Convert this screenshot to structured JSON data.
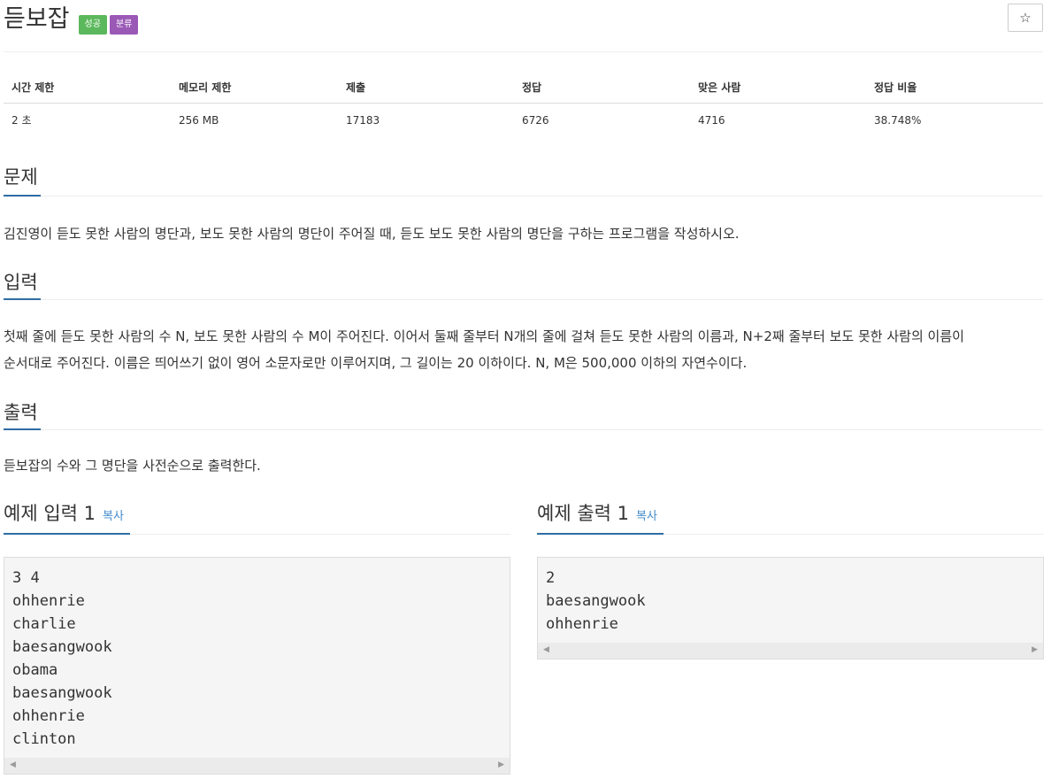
{
  "problem": {
    "title": "듣보잡",
    "badges": {
      "success": "성공",
      "category": "분류"
    },
    "star_icon": "☆"
  },
  "info_table": {
    "headers": [
      "시간 제한",
      "메모리 제한",
      "제출",
      "정답",
      "맞은 사람",
      "정답 비율"
    ],
    "values": [
      "2 초",
      "256 MB",
      "17183",
      "6726",
      "4716",
      "38.748%"
    ]
  },
  "sections": {
    "description": {
      "title": "문제",
      "text": "김진영이 듣도 못한 사람의 명단과, 보도 못한 사람의 명단이 주어질 때, 듣도 보도 못한 사람의 명단을 구하는 프로그램을 작성하시오."
    },
    "input": {
      "title": "입력",
      "line1": "첫째 줄에 듣도 못한 사람의 수 N, 보도 못한 사람의 수 M이 주어진다. 이어서 둘째 줄부터 N개의 줄에 걸쳐 듣도 못한 사람의 이름과, N+2째 줄부터 보도 못한 사람의 이름이",
      "line2": "순서대로 주어진다. 이름은 띄어쓰기 없이 영어 소문자로만 이루어지며, 그 길이는 20 이하이다. N, M은 500,000 이하의 자연수이다."
    },
    "output": {
      "title": "출력",
      "text": "듣보잡의 수와 그 명단을 사전순으로 출력한다."
    }
  },
  "samples": {
    "input": {
      "title": "예제 입력 1",
      "copy_label": "복사",
      "content": "3 4\nohhenrie\ncharlie\nbaesangwook\nobama\nbaesangwook\nohhenrie\nclinton"
    },
    "output": {
      "title": "예제 출력 1",
      "copy_label": "복사",
      "content": "2\nbaesangwook\nohhenrie"
    }
  },
  "colors": {
    "success_badge": "#5cb85c",
    "category_badge": "#9b59b6",
    "section_underline": "#2e6da4",
    "link": "#428bca"
  }
}
